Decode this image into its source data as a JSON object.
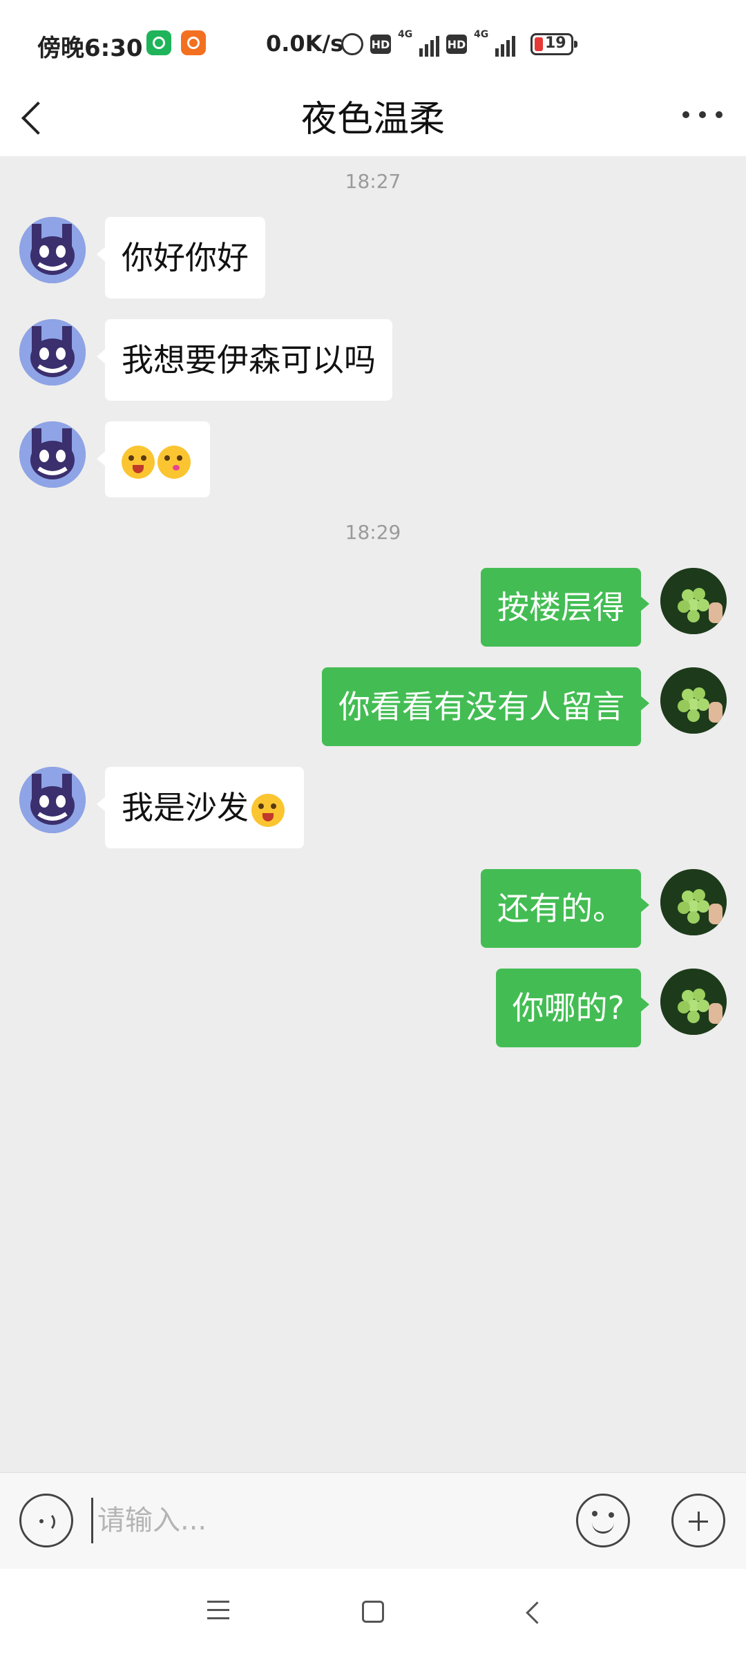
{
  "status_bar": {
    "time": "傍晚6:30",
    "net_speed": "0.0K/s",
    "network1": "4G",
    "network2": "4G",
    "hd1": "HD",
    "hd2": "HD",
    "battery": "19"
  },
  "header": {
    "title": "夜色温柔"
  },
  "timestamps": [
    "18:27",
    "18:29"
  ],
  "messages": [
    {
      "side": "in",
      "text": "你好你好"
    },
    {
      "side": "in",
      "text": "我想要伊森可以吗"
    },
    {
      "side": "in",
      "text": ""
    },
    {
      "side": "out",
      "text": "按楼层得"
    },
    {
      "side": "out",
      "text": "你看看有没有人留言"
    },
    {
      "side": "in",
      "text": "我是沙发"
    },
    {
      "side": "out",
      "text": "还有的。"
    },
    {
      "side": "out",
      "text": "你哪的?"
    }
  ],
  "input": {
    "placeholder": "请输入..."
  },
  "colors": {
    "outgoing_bubble": "#43bd53",
    "incoming_bubble": "#ffffff",
    "chat_background": "#ededed"
  }
}
